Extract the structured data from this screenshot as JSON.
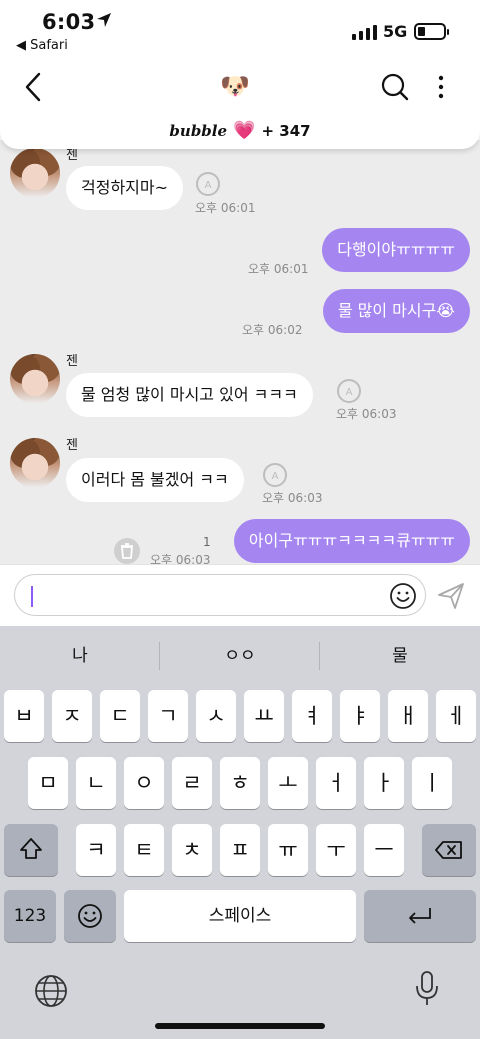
{
  "status_bar": {
    "time": "6:03",
    "back_app": "◀ Safari",
    "network": "5G"
  },
  "nav": {
    "title_emoji": "🐶"
  },
  "banner": {
    "brand": "bubble",
    "heart": "💗",
    "count": "+ 347"
  },
  "messages": [
    {
      "sender": "젠",
      "text": "걱정하지마~",
      "time": "오후 06:01"
    },
    {
      "text": "다행이야ㅠㅠㅠㅠ",
      "time": "오후 06:01"
    },
    {
      "text": "물 많이 마시구😭",
      "time": "오후 06:02"
    },
    {
      "sender": "젠",
      "text": "물 엄청 많이 마시고 있어 ㅋㅋㅋ",
      "time": "오후 06:03"
    },
    {
      "sender": "젠",
      "text": "이러다 몸 불겠어 ㅋㅋ",
      "time": "오후 06:03"
    },
    {
      "text": "아이구ㅠㅠㅠㅋㅋㅋㅋ큐ㅠㅠㅠ",
      "time": "오후 06:03",
      "unread": "1"
    }
  ],
  "input": {
    "value": "",
    "placeholder": ""
  },
  "keyboard": {
    "suggestions": [
      "나",
      "ㅇㅇ",
      "물"
    ],
    "row1": [
      "ㅂ",
      "ㅈ",
      "ㄷ",
      "ㄱ",
      "ㅅ",
      "ㅛ",
      "ㅕ",
      "ㅑ",
      "ㅐ",
      "ㅔ"
    ],
    "row2": [
      "ㅁ",
      "ㄴ",
      "ㅇ",
      "ㄹ",
      "ㅎ",
      "ㅗ",
      "ㅓ",
      "ㅏ",
      "ㅣ"
    ],
    "row3": [
      "ㅋ",
      "ㅌ",
      "ㅊ",
      "ㅍ",
      "ㅠ",
      "ㅜ",
      "ㅡ"
    ],
    "numbers_label": "123",
    "space_label": "스페이스"
  },
  "colors": {
    "outgoing_bubble": "#a585f0",
    "chat_background": "#ececec",
    "caret": "#8b5cf6"
  }
}
